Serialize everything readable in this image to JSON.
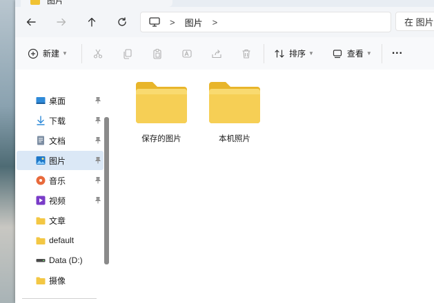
{
  "tab": {
    "title": "图片",
    "icon": "folder-icon"
  },
  "nav": {
    "back_icon": "arrow-left-icon",
    "forward_icon": "arrow-right-icon",
    "up_icon": "arrow-up-icon",
    "refresh_icon": "refresh-icon"
  },
  "address": {
    "root_icon": "this-pc-icon",
    "separator": ">",
    "crumb": "图片",
    "trailing_separator": ">"
  },
  "search": {
    "placeholder": "在 图片"
  },
  "toolbar": {
    "new_label": "新建",
    "sort_label": "排序",
    "view_label": "查看",
    "more_label": "···",
    "icons": [
      "cut-icon",
      "copy-icon",
      "paste-icon",
      "rename-icon",
      "share-icon",
      "delete-icon"
    ]
  },
  "sidebar": {
    "items": [
      {
        "label": "桌面",
        "icon": "desktop-icon",
        "pinned": true
      },
      {
        "label": "下载",
        "icon": "download-icon",
        "pinned": true
      },
      {
        "label": "文档",
        "icon": "document-icon",
        "pinned": true
      },
      {
        "label": "图片",
        "icon": "picture-icon",
        "pinned": true,
        "selected": true
      },
      {
        "label": "音乐",
        "icon": "music-icon",
        "pinned": true
      },
      {
        "label": "视频",
        "icon": "video-icon",
        "pinned": true
      },
      {
        "label": "文章",
        "icon": "folder-icon",
        "pinned": false
      },
      {
        "label": "default",
        "icon": "folder-icon",
        "pinned": false
      },
      {
        "label": "Data (D:)",
        "icon": "drive-icon",
        "pinned": false
      },
      {
        "label": "摄像",
        "icon": "folder-icon",
        "pinned": false
      }
    ]
  },
  "folders": [
    {
      "label": "保存的图片"
    },
    {
      "label": "本机照片"
    }
  ],
  "colors": {
    "folder": "#f3c744",
    "folder_tab": "#e8b52a",
    "selected_bg": "#dbe8f6",
    "toolbar_bg": "#f8f9fb"
  }
}
